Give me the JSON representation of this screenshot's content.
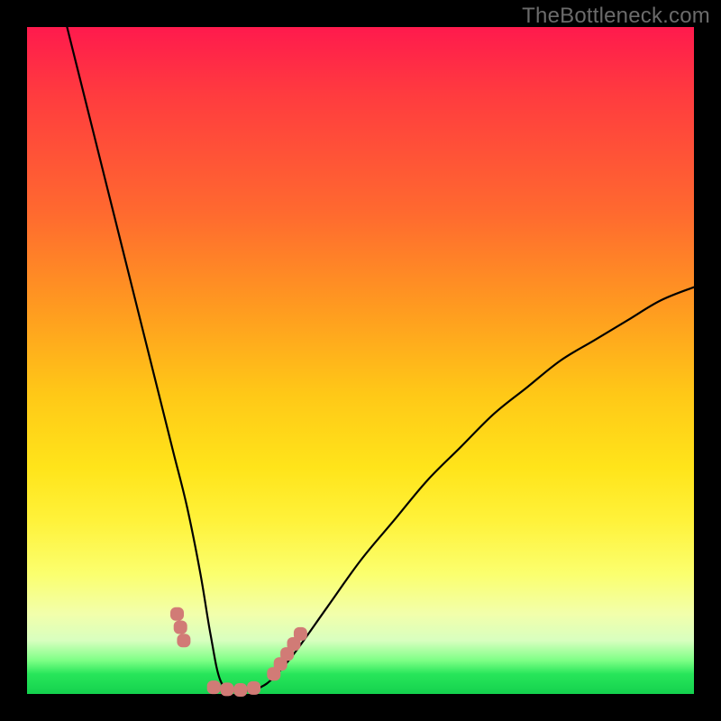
{
  "watermark": "TheBottleneck.com",
  "colors": {
    "frame": "#000000",
    "gradient_top": "#ff1a4d",
    "gradient_mid": "#ffe41a",
    "gradient_bottom": "#14d14e",
    "curve": "#000000",
    "marker": "#d17b76"
  },
  "chart_data": {
    "type": "line",
    "title": "",
    "xlabel": "",
    "ylabel": "",
    "xlim": [
      0,
      100
    ],
    "ylim": [
      0,
      100
    ],
    "series": [
      {
        "name": "bottleneck-curve",
        "x": [
          6,
          8,
          10,
          12,
          14,
          16,
          18,
          20,
          22,
          24,
          26,
          27.5,
          29,
          31,
          33,
          35,
          37,
          40,
          45,
          50,
          55,
          60,
          65,
          70,
          75,
          80,
          85,
          90,
          95,
          100
        ],
        "y": [
          100,
          92,
          84,
          76,
          68,
          60,
          52,
          44,
          36,
          28,
          18,
          9,
          2,
          0.5,
          0.5,
          1,
          2.5,
          6,
          13,
          20,
          26,
          32,
          37,
          42,
          46,
          50,
          53,
          56,
          59,
          61
        ]
      }
    ],
    "markers": [
      {
        "x": 22.5,
        "y": 12
      },
      {
        "x": 23.0,
        "y": 10
      },
      {
        "x": 23.5,
        "y": 8
      },
      {
        "x": 28.0,
        "y": 1.0
      },
      {
        "x": 30.0,
        "y": 0.7
      },
      {
        "x": 32.0,
        "y": 0.6
      },
      {
        "x": 34.0,
        "y": 0.9
      },
      {
        "x": 37.0,
        "y": 3
      },
      {
        "x": 38.0,
        "y": 4.5
      },
      {
        "x": 39.0,
        "y": 6
      },
      {
        "x": 40.0,
        "y": 7.5
      },
      {
        "x": 41.0,
        "y": 9
      }
    ]
  }
}
